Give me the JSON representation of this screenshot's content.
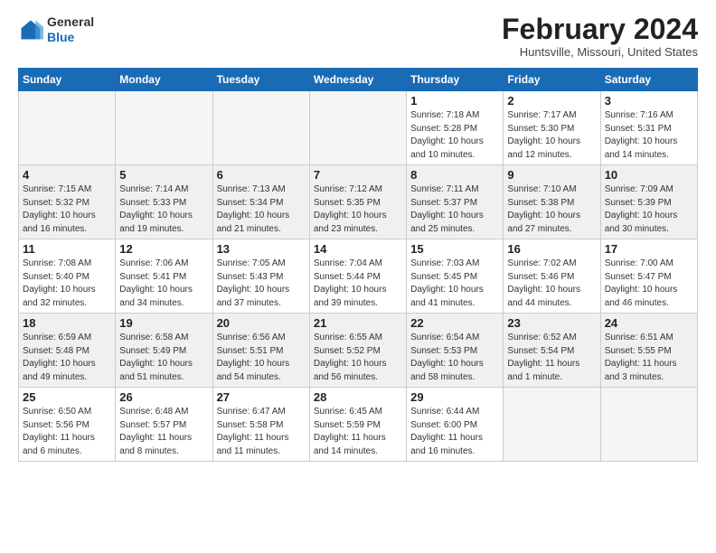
{
  "header": {
    "logo_line1": "General",
    "logo_line2": "Blue",
    "month": "February 2024",
    "location": "Huntsville, Missouri, United States"
  },
  "weekdays": [
    "Sunday",
    "Monday",
    "Tuesday",
    "Wednesday",
    "Thursday",
    "Friday",
    "Saturday"
  ],
  "weeks": [
    [
      {
        "day": "",
        "info": ""
      },
      {
        "day": "",
        "info": ""
      },
      {
        "day": "",
        "info": ""
      },
      {
        "day": "",
        "info": ""
      },
      {
        "day": "1",
        "info": "Sunrise: 7:18 AM\nSunset: 5:28 PM\nDaylight: 10 hours\nand 10 minutes."
      },
      {
        "day": "2",
        "info": "Sunrise: 7:17 AM\nSunset: 5:30 PM\nDaylight: 10 hours\nand 12 minutes."
      },
      {
        "day": "3",
        "info": "Sunrise: 7:16 AM\nSunset: 5:31 PM\nDaylight: 10 hours\nand 14 minutes."
      }
    ],
    [
      {
        "day": "4",
        "info": "Sunrise: 7:15 AM\nSunset: 5:32 PM\nDaylight: 10 hours\nand 16 minutes."
      },
      {
        "day": "5",
        "info": "Sunrise: 7:14 AM\nSunset: 5:33 PM\nDaylight: 10 hours\nand 19 minutes."
      },
      {
        "day": "6",
        "info": "Sunrise: 7:13 AM\nSunset: 5:34 PM\nDaylight: 10 hours\nand 21 minutes."
      },
      {
        "day": "7",
        "info": "Sunrise: 7:12 AM\nSunset: 5:35 PM\nDaylight: 10 hours\nand 23 minutes."
      },
      {
        "day": "8",
        "info": "Sunrise: 7:11 AM\nSunset: 5:37 PM\nDaylight: 10 hours\nand 25 minutes."
      },
      {
        "day": "9",
        "info": "Sunrise: 7:10 AM\nSunset: 5:38 PM\nDaylight: 10 hours\nand 27 minutes."
      },
      {
        "day": "10",
        "info": "Sunrise: 7:09 AM\nSunset: 5:39 PM\nDaylight: 10 hours\nand 30 minutes."
      }
    ],
    [
      {
        "day": "11",
        "info": "Sunrise: 7:08 AM\nSunset: 5:40 PM\nDaylight: 10 hours\nand 32 minutes."
      },
      {
        "day": "12",
        "info": "Sunrise: 7:06 AM\nSunset: 5:41 PM\nDaylight: 10 hours\nand 34 minutes."
      },
      {
        "day": "13",
        "info": "Sunrise: 7:05 AM\nSunset: 5:43 PM\nDaylight: 10 hours\nand 37 minutes."
      },
      {
        "day": "14",
        "info": "Sunrise: 7:04 AM\nSunset: 5:44 PM\nDaylight: 10 hours\nand 39 minutes."
      },
      {
        "day": "15",
        "info": "Sunrise: 7:03 AM\nSunset: 5:45 PM\nDaylight: 10 hours\nand 41 minutes."
      },
      {
        "day": "16",
        "info": "Sunrise: 7:02 AM\nSunset: 5:46 PM\nDaylight: 10 hours\nand 44 minutes."
      },
      {
        "day": "17",
        "info": "Sunrise: 7:00 AM\nSunset: 5:47 PM\nDaylight: 10 hours\nand 46 minutes."
      }
    ],
    [
      {
        "day": "18",
        "info": "Sunrise: 6:59 AM\nSunset: 5:48 PM\nDaylight: 10 hours\nand 49 minutes."
      },
      {
        "day": "19",
        "info": "Sunrise: 6:58 AM\nSunset: 5:49 PM\nDaylight: 10 hours\nand 51 minutes."
      },
      {
        "day": "20",
        "info": "Sunrise: 6:56 AM\nSunset: 5:51 PM\nDaylight: 10 hours\nand 54 minutes."
      },
      {
        "day": "21",
        "info": "Sunrise: 6:55 AM\nSunset: 5:52 PM\nDaylight: 10 hours\nand 56 minutes."
      },
      {
        "day": "22",
        "info": "Sunrise: 6:54 AM\nSunset: 5:53 PM\nDaylight: 10 hours\nand 58 minutes."
      },
      {
        "day": "23",
        "info": "Sunrise: 6:52 AM\nSunset: 5:54 PM\nDaylight: 11 hours\nand 1 minute."
      },
      {
        "day": "24",
        "info": "Sunrise: 6:51 AM\nSunset: 5:55 PM\nDaylight: 11 hours\nand 3 minutes."
      }
    ],
    [
      {
        "day": "25",
        "info": "Sunrise: 6:50 AM\nSunset: 5:56 PM\nDaylight: 11 hours\nand 6 minutes."
      },
      {
        "day": "26",
        "info": "Sunrise: 6:48 AM\nSunset: 5:57 PM\nDaylight: 11 hours\nand 8 minutes."
      },
      {
        "day": "27",
        "info": "Sunrise: 6:47 AM\nSunset: 5:58 PM\nDaylight: 11 hours\nand 11 minutes."
      },
      {
        "day": "28",
        "info": "Sunrise: 6:45 AM\nSunset: 5:59 PM\nDaylight: 11 hours\nand 14 minutes."
      },
      {
        "day": "29",
        "info": "Sunrise: 6:44 AM\nSunset: 6:00 PM\nDaylight: 11 hours\nand 16 minutes."
      },
      {
        "day": "",
        "info": ""
      },
      {
        "day": "",
        "info": ""
      }
    ]
  ]
}
